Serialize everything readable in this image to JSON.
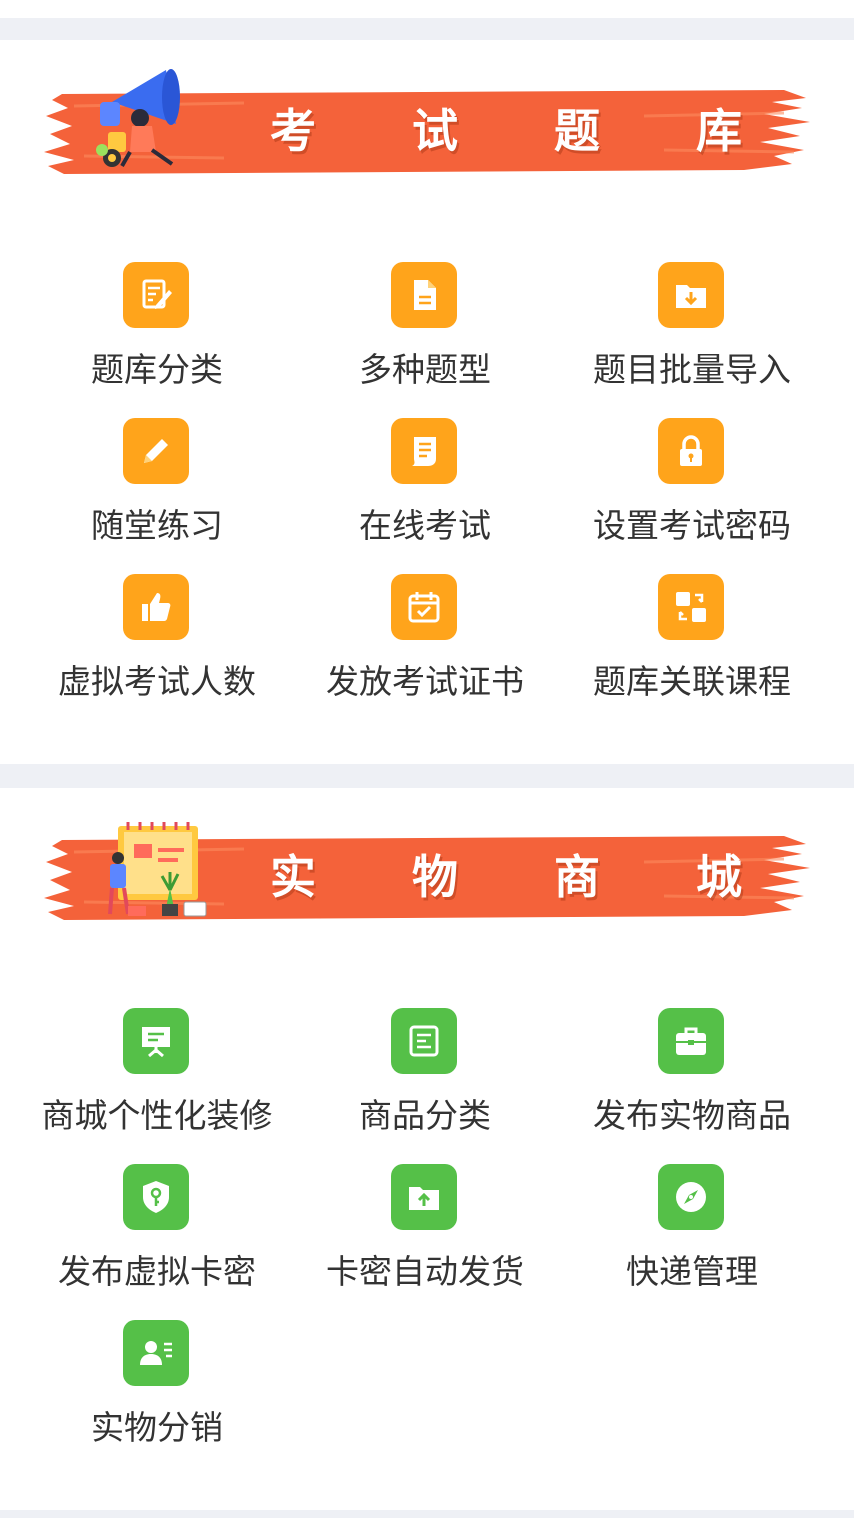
{
  "exam_section": {
    "title": "考 试 题 库",
    "items": [
      {
        "label": "题库分类",
        "icon": "edit-doc-icon"
      },
      {
        "label": "多种题型",
        "icon": "document-icon"
      },
      {
        "label": "题目批量导入",
        "icon": "folder-download-icon"
      },
      {
        "label": "随堂练习",
        "icon": "pencil-icon"
      },
      {
        "label": "在线考试",
        "icon": "exam-paper-icon"
      },
      {
        "label": "设置考试密码",
        "icon": "lock-icon"
      },
      {
        "label": "虚拟考试人数",
        "icon": "thumbs-up-icon"
      },
      {
        "label": "发放考试证书",
        "icon": "calendar-check-icon"
      },
      {
        "label": "题库关联课程",
        "icon": "link-swap-icon"
      }
    ]
  },
  "mall_section": {
    "title": "实 物 商 城",
    "items": [
      {
        "label": "商城个性化装修",
        "icon": "presentation-board-icon"
      },
      {
        "label": "商品分类",
        "icon": "list-icon"
      },
      {
        "label": "发布实物商品",
        "icon": "briefcase-icon"
      },
      {
        "label": "发布虚拟卡密",
        "icon": "shield-key-icon"
      },
      {
        "label": "卡密自动发货",
        "icon": "folder-upload-icon"
      },
      {
        "label": "快递管理",
        "icon": "compass-icon"
      },
      {
        "label": "实物分销",
        "icon": "contact-card-icon"
      }
    ]
  },
  "colors": {
    "orange_icon": "#ffa41b",
    "green_icon": "#55c048",
    "banner_brush": "#f4623a",
    "divider": "#eef0f5"
  }
}
